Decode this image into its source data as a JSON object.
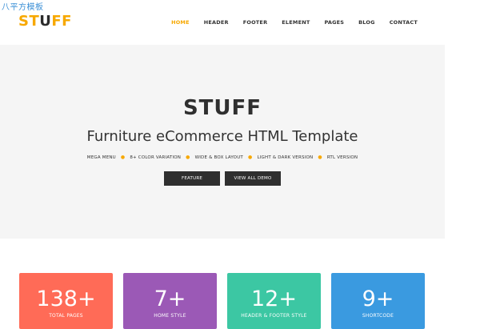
{
  "watermark": "八平方模板",
  "logo": {
    "part1": "ST",
    "part2": "U",
    "part3": "FF"
  },
  "nav": {
    "items": [
      {
        "label": "HOME",
        "active": true
      },
      {
        "label": "HEADER"
      },
      {
        "label": "FOOTER"
      },
      {
        "label": "ELEMENT"
      },
      {
        "label": "PAGES"
      },
      {
        "label": "BLOG"
      },
      {
        "label": "CONTACT"
      }
    ]
  },
  "hero": {
    "title": "STUFF",
    "subtitle": "Furniture eCommerce HTML Template",
    "features": [
      "MEGA MENU",
      "8+ COLOR VARIATION",
      "WIDE & BOX LAYOUT",
      "LIGHT & DARK VERSION",
      "RTL VERSION"
    ],
    "feature_button": "FEATURE",
    "demo_button": "VIEW ALL DEMO"
  },
  "stats": [
    {
      "number": "138+",
      "label": "TOTAL PAGES",
      "color": "#ff6b57"
    },
    {
      "number": "7+",
      "label": "HOME STYLE",
      "color": "#9b59b6"
    },
    {
      "number": "12+",
      "label": "HEADER & FOOTER STYLE",
      "color": "#3cc7a3"
    },
    {
      "number": "9+",
      "label": "SHORTCODE",
      "color": "#3a9ae0"
    }
  ],
  "colors": {
    "accent": "#f7a800",
    "hero_bg": "#f5f5f5",
    "button_bg": "#2f2f2f"
  }
}
